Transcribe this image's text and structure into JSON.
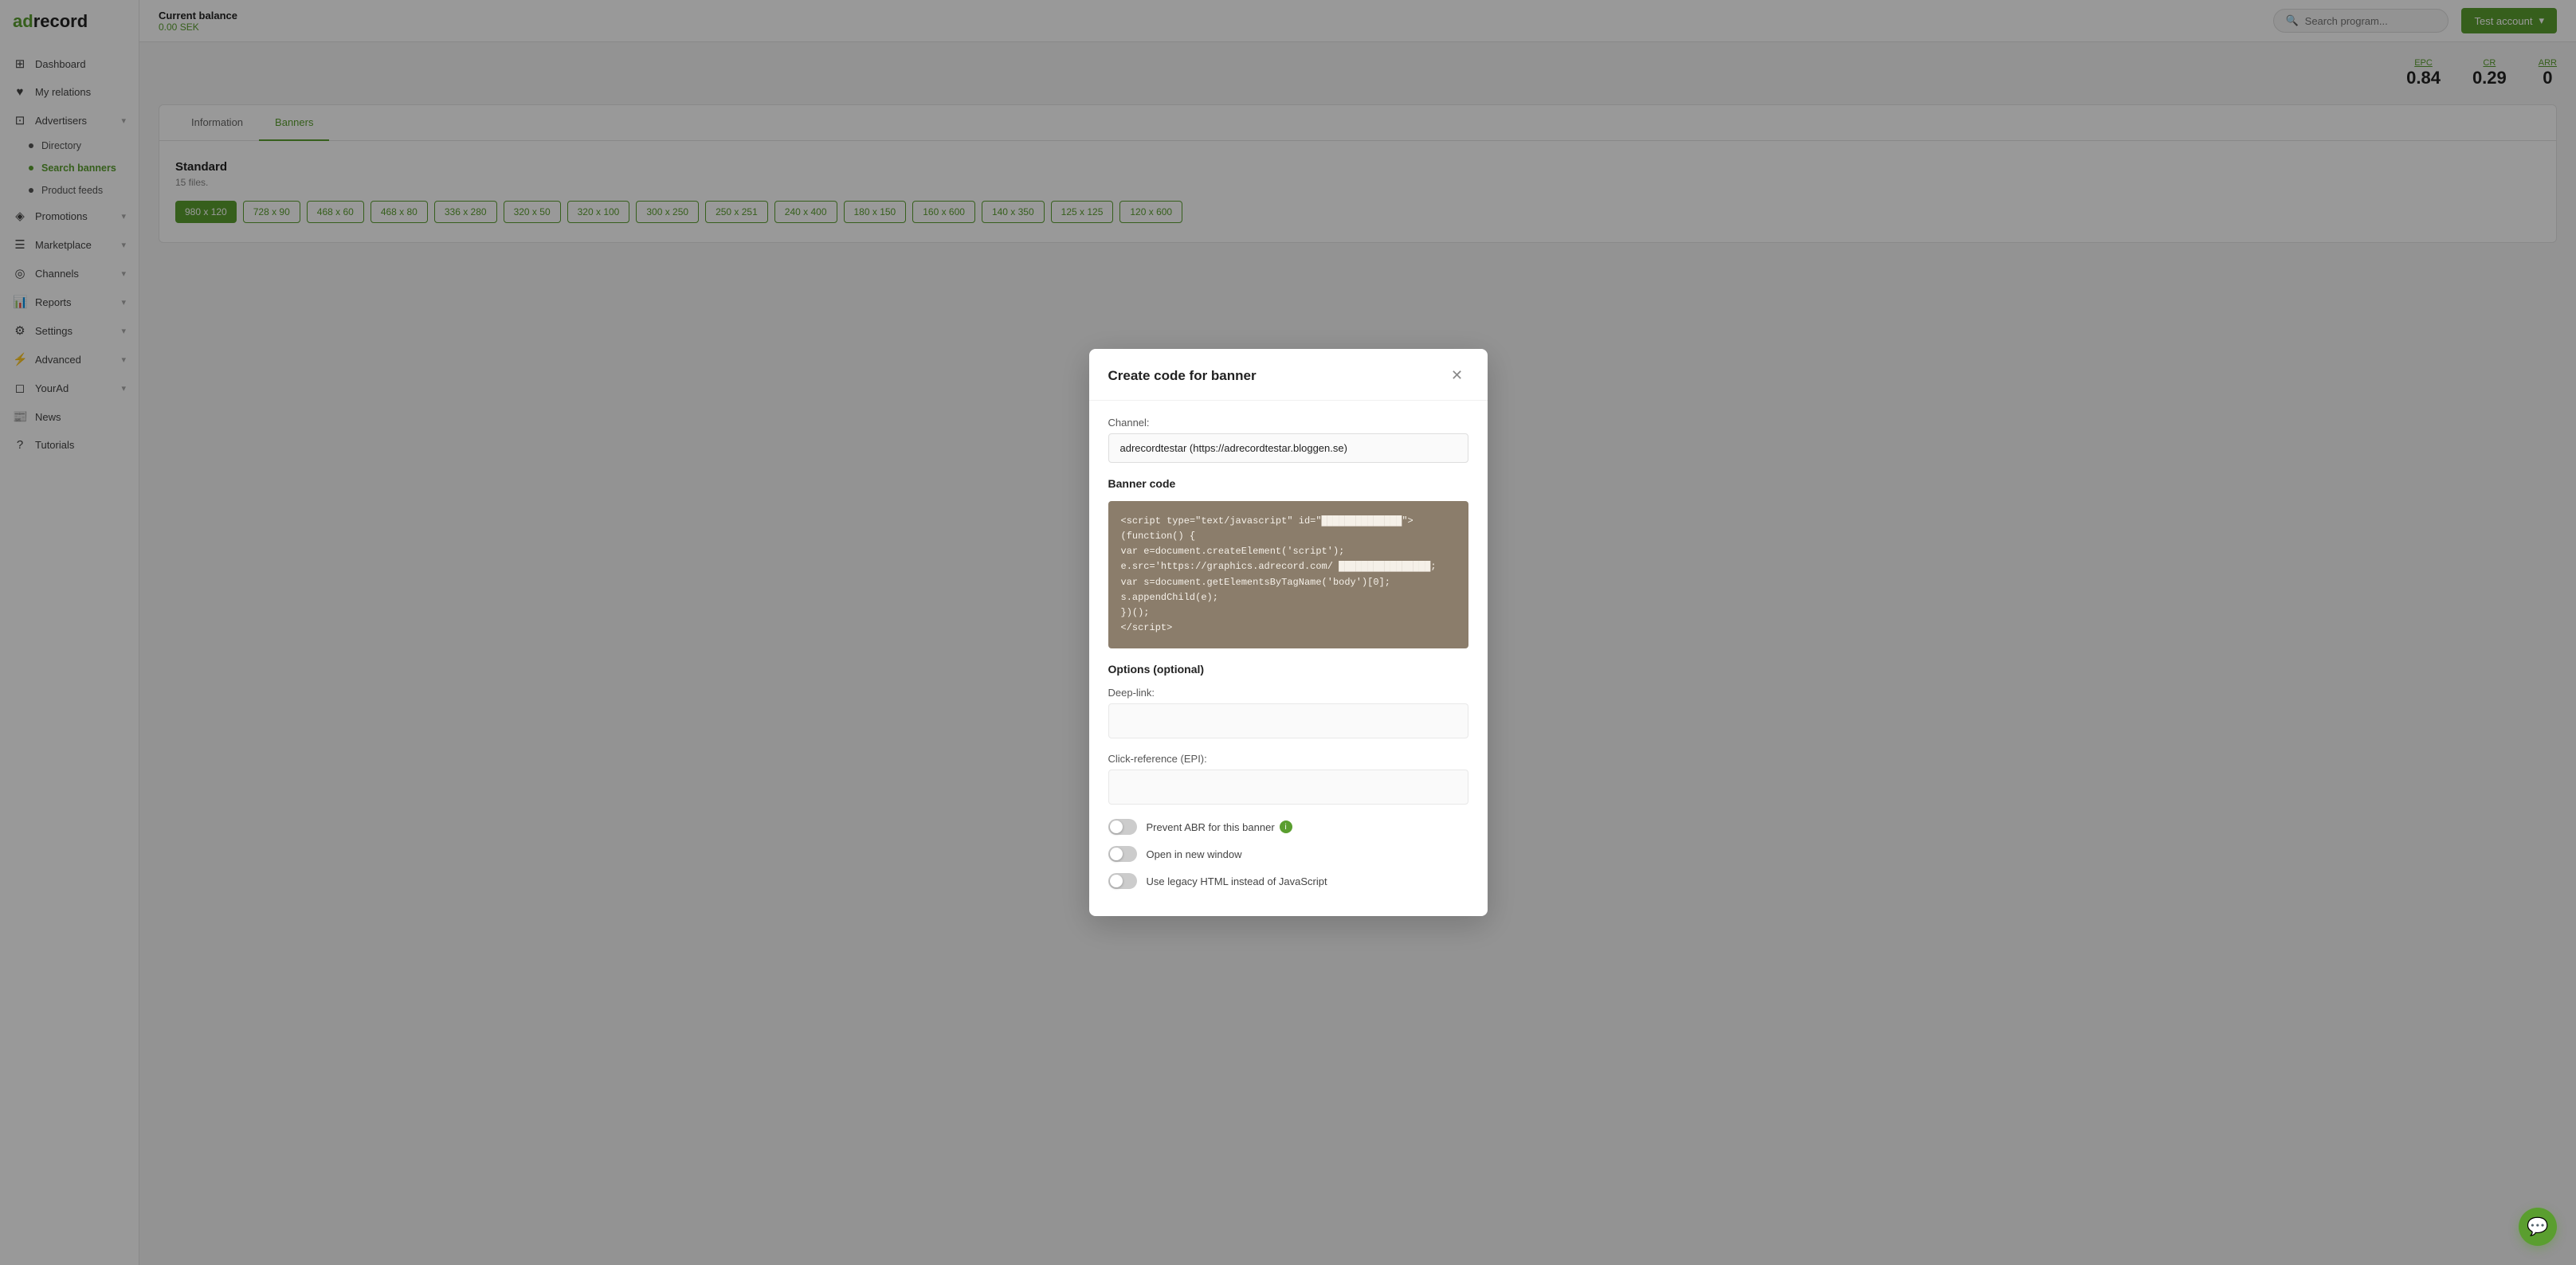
{
  "app": {
    "name": "adrecord",
    "logo_green": "ad",
    "logo_black": "record"
  },
  "header": {
    "balance_label": "Current balance",
    "balance_amount": "0.00 SEK",
    "search_placeholder": "Search program...",
    "account_button": "Test account"
  },
  "sidebar": {
    "items": [
      {
        "id": "dashboard",
        "label": "Dashboard",
        "icon": "⊞",
        "has_chevron": false
      },
      {
        "id": "my-relations",
        "label": "My relations",
        "icon": "♥",
        "has_chevron": false
      },
      {
        "id": "advertisers",
        "label": "Advertisers",
        "icon": "⊡",
        "has_chevron": true,
        "children": [
          {
            "id": "directory",
            "label": "Directory"
          },
          {
            "id": "search-banners",
            "label": "Search banners",
            "active": true
          }
        ]
      },
      {
        "id": "product-feeds-nav",
        "label": "Product feeds",
        "icon": "≡",
        "has_chevron": false,
        "children": [
          {
            "id": "product-feeds-item",
            "label": "Product feeds"
          }
        ]
      },
      {
        "id": "promotions",
        "label": "Promotions",
        "icon": "◈",
        "has_chevron": true
      },
      {
        "id": "marketplace",
        "label": "Marketplace",
        "icon": "☰",
        "has_chevron": true
      },
      {
        "id": "channels",
        "label": "Channels",
        "icon": "◎",
        "has_chevron": true
      },
      {
        "id": "reports",
        "label": "Reports",
        "icon": "📊",
        "has_chevron": true
      },
      {
        "id": "settings",
        "label": "Settings",
        "icon": "⚙",
        "has_chevron": true
      },
      {
        "id": "advanced",
        "label": "Advanced",
        "icon": "⚡",
        "has_chevron": true
      },
      {
        "id": "yourad",
        "label": "YourAd",
        "icon": "◻",
        "has_chevron": true
      },
      {
        "id": "news",
        "label": "News",
        "icon": "📰",
        "has_chevron": false
      },
      {
        "id": "tutorials",
        "label": "Tutorials",
        "icon": "?",
        "has_chevron": false
      }
    ]
  },
  "stats": {
    "epc_label": "EPC",
    "epc_value": "0.84",
    "cr_label": "CR",
    "cr_value": "0.29",
    "arr_label": "ARR",
    "arr_value": "0"
  },
  "page": {
    "tabs": [
      "Information",
      "Banners"
    ],
    "active_tab": "Banners",
    "banners": {
      "section_title": "Standard",
      "files_count": "15 files.",
      "sizes": [
        "980 x 120",
        "728 x 90",
        "468 x 60",
        "468 x 80",
        "336 x 280",
        "320 x 50",
        "320 x 100",
        "300 x 250",
        "250 x 251",
        "240 x 400",
        "180 x 150",
        "160 x 600",
        "140 x 350",
        "125 x 125",
        "120 x 600"
      ]
    }
  },
  "modal": {
    "title": "Create code for banner",
    "channel_label": "Channel:",
    "channel_value": "adrecordtestar (https://adrecordtestar.bloggen.se)",
    "banner_code_label": "Banner code",
    "banner_code_lines": [
      "<script type=\"text/javascript\" id=\"██████████████\">",
      "(function() {",
      "var e=document.createElement('script');",
      "e.src='https://graphics.adrecord.com/ ████████████████;",
      "var s=document.getElementsByTagName('body')[0]; s.appendChild(e);",
      "})();",
      "</script>"
    ],
    "options_title": "Options (optional)",
    "deep_link_label": "Deep-link:",
    "deep_link_placeholder": "",
    "click_ref_label": "Click-reference (EPI):",
    "click_ref_placeholder": "",
    "toggles": [
      {
        "id": "prevent-abr",
        "label": "Prevent ABR for this banner",
        "has_info": true,
        "on": false
      },
      {
        "id": "open-new-window",
        "label": "Open in new window",
        "has_info": false,
        "on": false
      },
      {
        "id": "use-legacy-html",
        "label": "Use legacy HTML instead of JavaScript",
        "has_info": false,
        "on": false
      }
    ]
  },
  "chat": {
    "icon": "💬"
  }
}
